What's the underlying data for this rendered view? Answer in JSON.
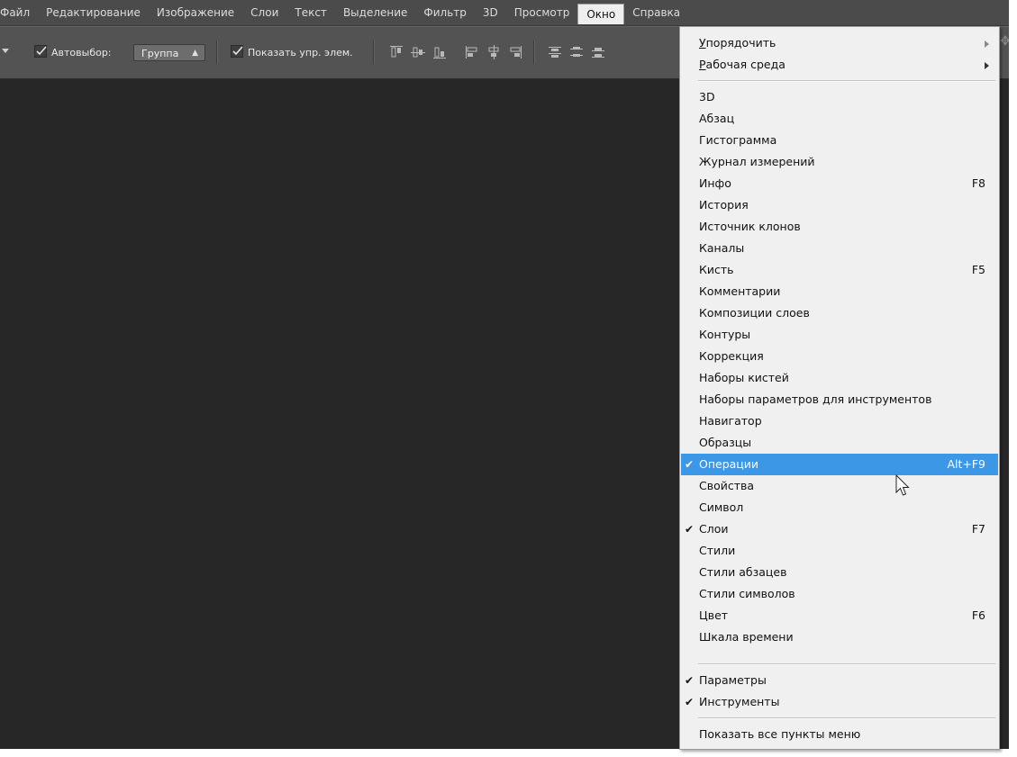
{
  "menubar": {
    "items": [
      "Файл",
      "Редактирование",
      "Изображение",
      "Слои",
      "Текст",
      "Выделение",
      "Фильтр",
      "3D",
      "Просмотр",
      "Окно",
      "Справка"
    ]
  },
  "options": {
    "autoselect_label": "Автовыбор:",
    "autoselect_value": "Группа",
    "show_controls_label": "Показать упр. элем."
  },
  "window_menu": {
    "arrange": "порядочить",
    "arrange_u": "У",
    "workspace": "абочая среда",
    "workspace_u": "Р",
    "panels": [
      {
        "label": "3D",
        "shortcut": ""
      },
      {
        "label": "Абзац",
        "shortcut": ""
      },
      {
        "label": "Гистограмма",
        "shortcut": ""
      },
      {
        "label": "Журнал измерений",
        "shortcut": ""
      },
      {
        "label": "Инфо",
        "shortcut": "F8"
      },
      {
        "label": "История",
        "shortcut": ""
      },
      {
        "label": "Источник клонов",
        "shortcut": ""
      },
      {
        "label": "Каналы",
        "shortcut": ""
      },
      {
        "label": "Кисть",
        "shortcut": "F5"
      },
      {
        "label": "Комментарии",
        "shortcut": ""
      },
      {
        "label": "Композиции слоев",
        "shortcut": ""
      },
      {
        "label": "Контуры",
        "shortcut": ""
      },
      {
        "label": "Коррекция",
        "shortcut": ""
      },
      {
        "label": "Наборы кистей",
        "shortcut": ""
      },
      {
        "label": "Наборы параметров для инструментов",
        "shortcut": ""
      },
      {
        "label": "Навигатор",
        "shortcut": ""
      },
      {
        "label": "Образцы",
        "shortcut": ""
      },
      {
        "label": "Операции",
        "shortcut": "Alt+F9"
      },
      {
        "label": "Свойства",
        "shortcut": ""
      },
      {
        "label": "Символ",
        "shortcut": ""
      },
      {
        "label": "Слои",
        "shortcut": "F7"
      },
      {
        "label": "Стили",
        "shortcut": ""
      },
      {
        "label": "Стили абзацев",
        "shortcut": ""
      },
      {
        "label": "Стили символов",
        "shortcut": ""
      },
      {
        "label": "Цвет",
        "shortcut": "F6"
      },
      {
        "label": "Шкала времени",
        "shortcut": ""
      }
    ],
    "options_item": "Параметры",
    "tools_item": "Инструменты",
    "show_all": "Показать все пункты меню",
    "check_glyph": "✔"
  }
}
